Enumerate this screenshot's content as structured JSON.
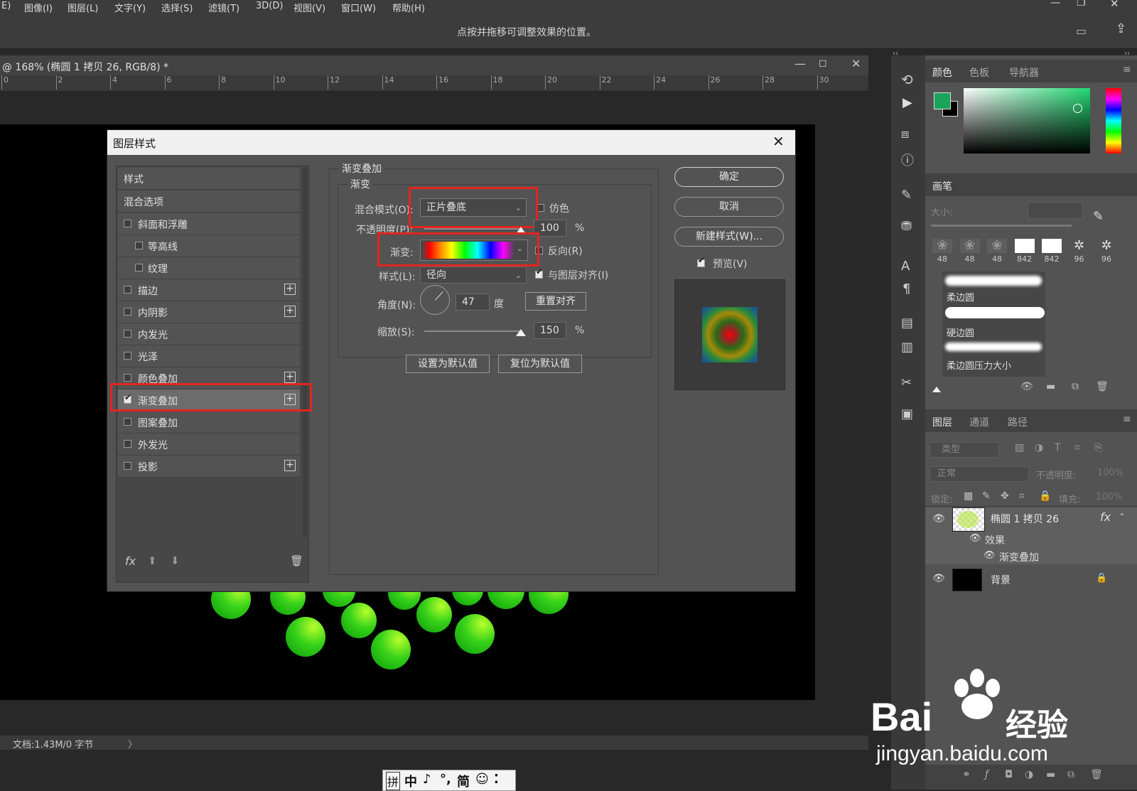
{
  "menubar": [
    "E)",
    "图像(I)",
    "图层(L)",
    "文字(Y)",
    "选择(S)",
    "滤镜(T)",
    "3D(D)",
    "视图(V)",
    "窗口(W)",
    "帮助(H)"
  ],
  "options_hint": "点按并拖移可调整效果的位置。",
  "doc_tab": "@ 168% (椭圆 1 拷贝 26, RGB/8) *",
  "ruler_marks": [
    "0",
    "2",
    "4",
    "6",
    "8",
    "10",
    "12",
    "14",
    "16",
    "18",
    "20",
    "22",
    "24",
    "26",
    "28",
    "30"
  ],
  "status": "文档:1.43M/0 字节",
  "ime": [
    "拼",
    "中",
    "♪",
    "°,",
    "简",
    "☺",
    "⁚"
  ],
  "dialog": {
    "title": "图层样式",
    "styles_header": "样式",
    "blend_options": "混合选项",
    "items": [
      {
        "label": "斜面和浮雕",
        "checked": false,
        "indent": false,
        "plus": false
      },
      {
        "label": "等高线",
        "checked": false,
        "indent": true,
        "plus": false
      },
      {
        "label": "纹理",
        "checked": false,
        "indent": true,
        "plus": false
      },
      {
        "label": "描边",
        "checked": false,
        "indent": false,
        "plus": true
      },
      {
        "label": "内阴影",
        "checked": false,
        "indent": false,
        "plus": true
      },
      {
        "label": "内发光",
        "checked": false,
        "indent": false,
        "plus": false
      },
      {
        "label": "光泽",
        "checked": false,
        "indent": false,
        "plus": false
      },
      {
        "label": "颜色叠加",
        "checked": false,
        "indent": false,
        "plus": true
      },
      {
        "label": "渐变叠加",
        "checked": true,
        "indent": false,
        "plus": true
      },
      {
        "label": "图案叠加",
        "checked": false,
        "indent": false,
        "plus": false
      },
      {
        "label": "外发光",
        "checked": false,
        "indent": false,
        "plus": false
      },
      {
        "label": "投影",
        "checked": false,
        "indent": false,
        "plus": true
      }
    ],
    "fx_label": "fx",
    "section_title": "渐变叠加",
    "group_title": "渐变",
    "blend_mode_label": "混合模式(O):",
    "blend_mode_value": "正片叠底",
    "dither_label": "仿色",
    "opacity_label": "不透明度(P):",
    "opacity_value": "100",
    "opacity_percent": 100,
    "percent": "%",
    "gradient_label": "渐变:",
    "reverse_label": "反向(R)",
    "style_label": "样式(L):",
    "style_value": "径向",
    "align_label": "与图层对齐(I)",
    "angle_label": "角度(N):",
    "angle_value": "47",
    "degree": "度",
    "reset_align": "重置对齐",
    "scale_label": "缩放(S):",
    "scale_value": "150",
    "scale_percent": 150,
    "set_default": "设置为默认值",
    "reset_default": "复位为默认值",
    "ok": "确定",
    "cancel": "取消",
    "new_style": "新建样式(W)...",
    "preview": "预览(V)"
  },
  "panels": {
    "color_tabs": [
      "颜色",
      "色板",
      "导航器"
    ],
    "brush_title": "画笔",
    "size_label": "大小:",
    "brush_sizes": [
      "48",
      "48",
      "48",
      "842",
      "842",
      "96",
      "96"
    ],
    "brush_names": [
      "柔边圆",
      "硬边圆",
      "柔边圆压力大小"
    ],
    "layer_tabs": [
      "图层",
      "通道",
      "路径"
    ],
    "filter_placeholder": "类型",
    "blend_mode": "正常",
    "opacity_label": "不透明度:",
    "opacity_value": "100%",
    "lock_label": "锁定:",
    "fill_label": "填充:",
    "fill_value": "100%",
    "layer1": "椭圆 1 拷贝 26",
    "effects": "效果",
    "effect_item": "渐变叠加",
    "layer_bg": "背景"
  },
  "watermark": {
    "brand": "Bai",
    "brand2": "经验",
    "url": "jingyan.baidu.com"
  },
  "colors": {
    "accent_red": "#e3241e",
    "fg_swatch": "#1aa35a"
  }
}
